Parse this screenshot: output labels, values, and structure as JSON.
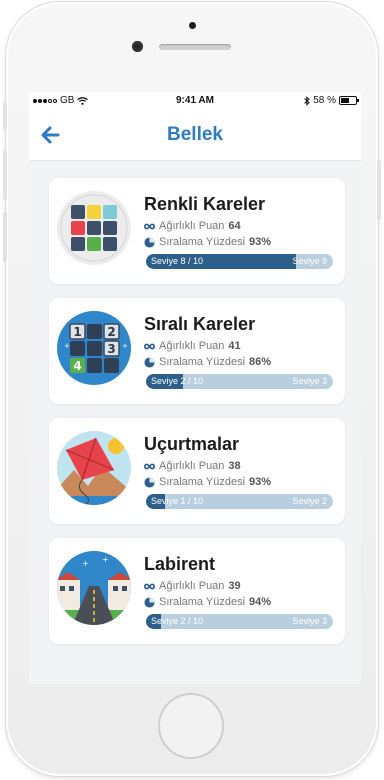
{
  "status_bar": {
    "carrier": "GB",
    "time": "9:41 AM",
    "battery": "58 %"
  },
  "nav": {
    "title": "Bellek"
  },
  "cards": [
    {
      "title": "Renkli Kareler",
      "points_label": "Ağırlıklı Puan",
      "points": "64",
      "percentile_label": "Sıralama Yüzdesi",
      "percentile": "93%",
      "level_text": "Seviye  8 / 10",
      "next_level": "Seviye  9",
      "progress": 0.8
    },
    {
      "title": "Sıralı Kareler",
      "points_label": "Ağırlıklı Puan",
      "points": "41",
      "percentile_label": "Sıralama Yüzdesi",
      "percentile": "86%",
      "level_text": "Seviye  2 / 10",
      "next_level": "Seviye  3",
      "progress": 0.2
    },
    {
      "title": "Uçurtmalar",
      "points_label": "Ağırlıklı Puan",
      "points": "38",
      "percentile_label": "Sıralama Yüzdesi",
      "percentile": "93%",
      "level_text": "Seviye  1 / 10",
      "next_level": "Seviye  2",
      "progress": 0.1
    },
    {
      "title": "Labirent",
      "points_label": "Ağırlıklı Puan",
      "points": "39",
      "percentile_label": "Sıralama Yüzdesi",
      "percentile": "94%",
      "level_text": "Seviye  2 / 10",
      "next_level": "Seviye  3",
      "progress": 0.08
    }
  ],
  "icons": {
    "back": "back-arrow-icon",
    "points": "infinity-icon",
    "percentile": "pie-chart-icon",
    "game1": "color-squares-icon",
    "game2": "numbered-squares-icon",
    "game3": "kite-icon",
    "game4": "maze-road-icon"
  },
  "colors": {
    "accent": "#2e7bc4",
    "progress_fill": "#2e5f8a",
    "progress_track": "#b9cfdf",
    "background": "#f1f3f6"
  }
}
